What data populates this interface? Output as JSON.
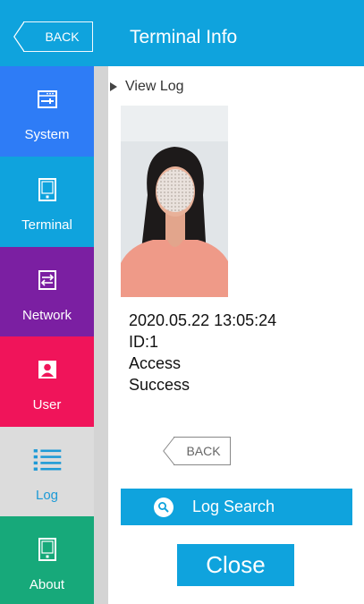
{
  "header": {
    "back_label": "BACK",
    "title": "Terminal Info"
  },
  "sidebar": {
    "items": [
      {
        "label": "System",
        "icon": "system-icon",
        "color": "#2e7cf6"
      },
      {
        "label": "Terminal",
        "icon": "terminal-icon",
        "color": "#0fa3dd"
      },
      {
        "label": "Network",
        "icon": "network-icon",
        "color": "#7b1fa2"
      },
      {
        "label": "User",
        "icon": "user-icon",
        "color": "#f0145a"
      },
      {
        "label": "Log",
        "icon": "log-list-icon",
        "color": "#dcdcdc",
        "active": true
      },
      {
        "label": "About",
        "icon": "about-icon",
        "color": "#17a97a"
      }
    ]
  },
  "main": {
    "section_title": "View Log",
    "log": {
      "datetime": "2020.05.22  13:05:24",
      "id": "ID:1",
      "access": "Access",
      "result": "Success"
    },
    "back_label": "BACK",
    "search_label": "Log Search",
    "close_label": "Close"
  },
  "colors": {
    "accent": "#0fa3dd",
    "system": "#2e7cf6",
    "network": "#7b1fa2",
    "user": "#f0145a",
    "about": "#17a97a"
  }
}
